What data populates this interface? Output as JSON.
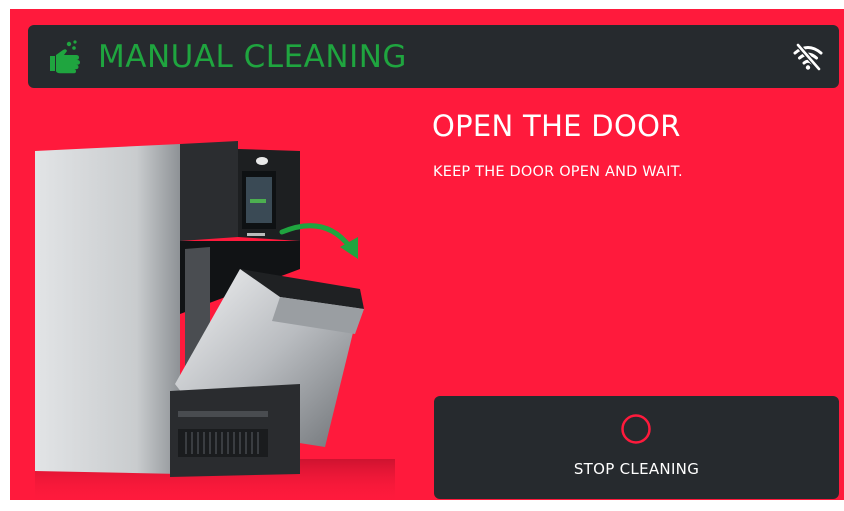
{
  "header": {
    "title": "MANUAL CLEANING",
    "left_icon": "hand-washing-icon",
    "right_icon": "wifi-off-icon",
    "title_color": "#1fa53f"
  },
  "instruction": {
    "headline": "OPEN THE DOOR",
    "detail": "KEEP THE DOOR OPEN AND WAIT."
  },
  "illustration": {
    "subject": "oven-open-door-icon",
    "arrow_color": "#1fa53f"
  },
  "stop_button": {
    "label": "STOP CLEANING",
    "icon": "ring-icon",
    "ring_color": "#ff1a3c"
  },
  "colors": {
    "background": "#ff1a3c",
    "panel": "#262a2e",
    "text": "#ffffff"
  }
}
